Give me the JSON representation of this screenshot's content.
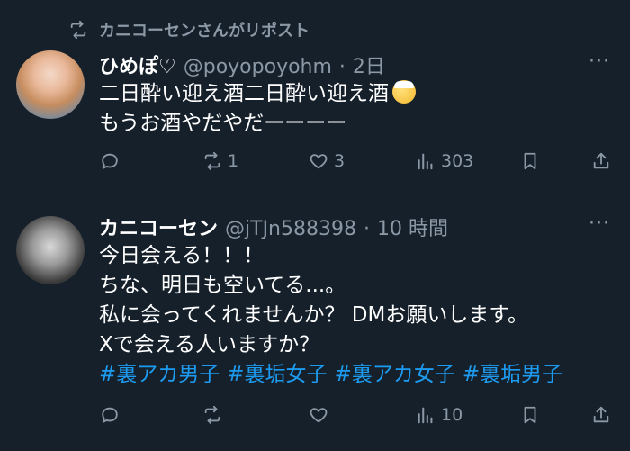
{
  "repost": {
    "text": "カニコーセンさんがリポスト"
  },
  "tweets": [
    {
      "name": "ひめぽ♡",
      "handle": "@poyopoyohm",
      "time": "2日",
      "more": "···",
      "lines": [
        "二日酔い迎え酒二日酔い迎え酒",
        "もうお酒やだやだーーーー"
      ],
      "emoji": "face-with-head-bandage-icon",
      "stats": {
        "replies": "",
        "reposts": "1",
        "likes": "3",
        "views": "303"
      }
    },
    {
      "name": "カニコーセン",
      "handle": "@jTJn588398",
      "time": "10 時間",
      "more": "···",
      "lines": [
        "今日会える！！！",
        "ちな、明日も空いてる...。",
        "私に会ってくれませんか？ DMお願いします。",
        "Xで会える人いますか？"
      ],
      "hashtags": [
        "#裏アカ男子",
        "#裏垢女子",
        "#裏アカ女子",
        "#裏垢男子"
      ],
      "stats": {
        "replies": "",
        "reposts": "",
        "likes": "",
        "views": "10"
      }
    }
  ],
  "colors": {
    "background": "#15202b",
    "muted": "#8b98a5",
    "link": "#1d9bf0",
    "divider": "#38444d"
  }
}
